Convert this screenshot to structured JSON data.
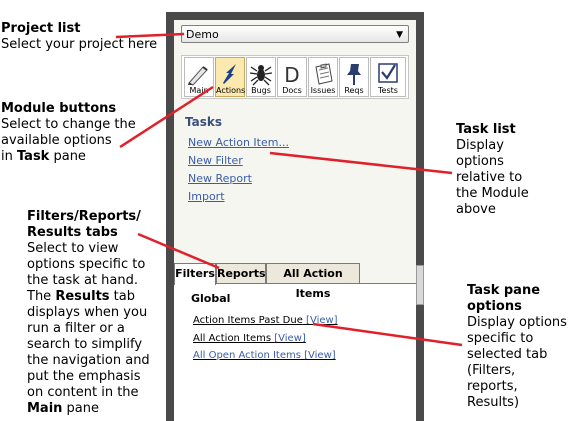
{
  "callouts": {
    "project_list": {
      "title": "Project list",
      "lines": [
        "Select your project here"
      ]
    },
    "module_buttons": {
      "title": "Module buttons",
      "lines": [
        "Select to change the",
        "available options",
        "in "
      ],
      "bold": "Task",
      "tail": " pane"
    },
    "task_list": {
      "title": "Task list",
      "lines": [
        "Display",
        "options",
        "relative to",
        "the Module",
        "above"
      ]
    },
    "filters_tabs": {
      "title_1": "Filters/Reports/",
      "title_2": "Results tabs",
      "lines": [
        "Select to view",
        "options specific to",
        "the task at hand.",
        "The "
      ],
      "results_bold": "Results",
      "after_results": " tab",
      "lines_2": [
        "displays when you",
        "run a filter or a",
        "search to simplify",
        "the navigation and",
        "put the emphasis",
        "on content in the"
      ],
      "main_bold": "Main",
      "after_main": " pane"
    },
    "task_pane": {
      "title_1": "Task pane",
      "title_2": "options",
      "lines": [
        "Display options",
        "specific to",
        "selected tab",
        "(Filters,",
        "reports,",
        "Results)"
      ]
    }
  },
  "project_select": {
    "value": "Demo"
  },
  "modules": [
    {
      "label": "Main",
      "icon": "pen-icon"
    },
    {
      "label": "Actions",
      "icon": "lightning-icon"
    },
    {
      "label": "Bugs",
      "icon": "spider-icon"
    },
    {
      "label": "Docs",
      "icon": "letter-d-icon"
    },
    {
      "label": "Issues",
      "icon": "clipboard-icon"
    },
    {
      "label": "Reqs",
      "icon": "pushpin-icon"
    },
    {
      "label": "Tests",
      "icon": "checkbox-icon"
    }
  ],
  "active_module": "Actions",
  "tasks": {
    "title": "Tasks",
    "links": [
      "New Action Item...",
      "New Filter",
      "New Report",
      "Import"
    ]
  },
  "tabs": {
    "items": [
      "Filters",
      "Reports",
      "All Action Items"
    ],
    "active": "Filters"
  },
  "pane": {
    "group": "Global",
    "items": [
      {
        "label": "Action Items Past Due",
        "view": "[View]"
      },
      {
        "label": "All Action Items",
        "view": "[View]"
      },
      {
        "label": "All Open Action Items",
        "view": "[View]"
      }
    ]
  },
  "colors": {
    "arrow": "#e0202a",
    "panel_border": "#4a4a4a",
    "link": "#3a5da8",
    "active_module_bg": "#fbe9b0"
  }
}
